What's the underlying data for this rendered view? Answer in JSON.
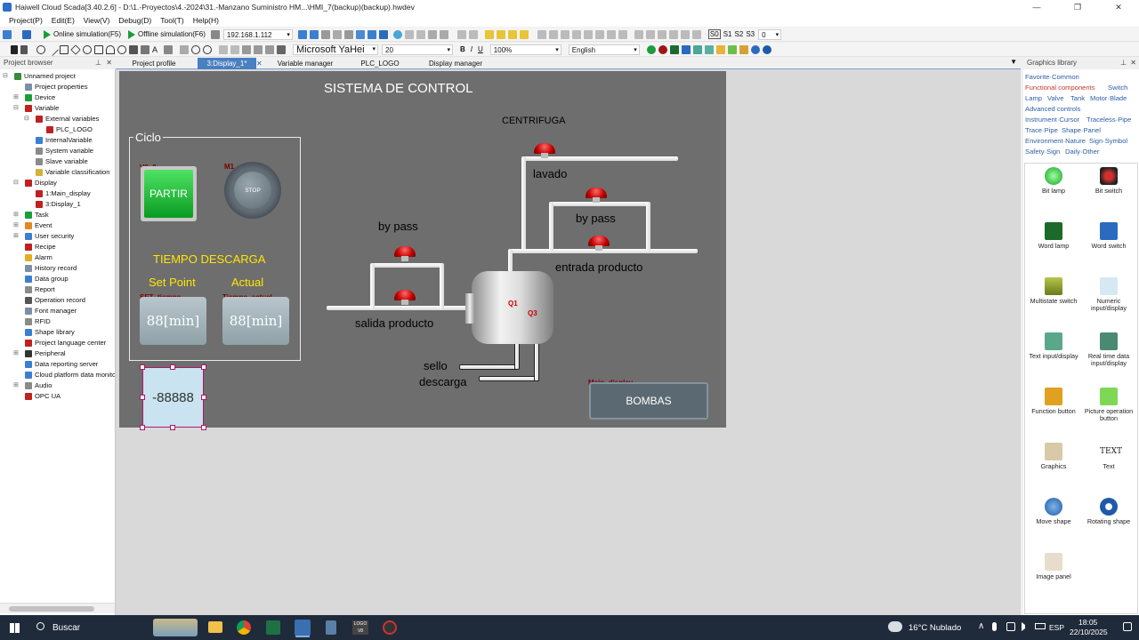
{
  "window": {
    "title": "Haiwell Cloud Scada[3.40.2.6] - D:\\1.-Proyectos\\4.-2024\\31.-Manzano Suministro HM...\\HMI_7(backup)(backup).hwdev",
    "minimize": "—",
    "maximize": "❐",
    "close": "✕"
  },
  "menu": [
    "Project(P)",
    "Edit(E)",
    "View(V)",
    "Debug(D)",
    "Tool(T)",
    "Help(H)"
  ],
  "toolbar1": {
    "online_sim": "Online simulation(F5)",
    "offline_sim": "Offline simulation(F6)",
    "ip": "192.168.1.112",
    "s0": "S0",
    "s1": "S1",
    "s2": "S2",
    "s3": "S3",
    "spin": "0"
  },
  "toolbar2": {
    "font": "Microsoft YaHei",
    "size": "20",
    "bold": "B",
    "italic": "I",
    "underline": "U",
    "zoom": "100%",
    "language": "English"
  },
  "tabs": [
    "Project profile",
    "3:Display_1*",
    "Variable manager",
    "PLC_LOGO",
    "Display manager"
  ],
  "project_browser": {
    "title": "Project browser",
    "items": [
      "Unnamed project",
      "Project properties",
      "Device",
      "Variable",
      "External variables",
      "PLC_LOGO",
      "InternalVariable",
      "System variable",
      "Slave variable",
      "Variable classification",
      "Display",
      "1:Main_display",
      "3:Display_1",
      "Task",
      "Event",
      "User security",
      "Recipe",
      "Alarm",
      "History record",
      "Data group",
      "Report",
      "Operation record",
      "Font manager",
      "RFID",
      "Shape library",
      "Project language center",
      "Peripheral",
      "Data reporting server",
      "Cloud platform data monito",
      "Audio",
      "OPC UA"
    ]
  },
  "display": {
    "title": "SISTEMA DE CONTROL",
    "ciclo": "Ciclo",
    "v0": "V0_0",
    "partir": "PARTIR",
    "m1": "M1",
    "stop": "STOP",
    "tiempo": "TIEMPO DESCARGA",
    "setpoint": "Set Point",
    "actual": "Actual",
    "set_tag": "SET_tiempo",
    "act_tag": "Tiempo_actual",
    "set_val": "88[min]",
    "act_val": "88[min]",
    "numeric": "-88888",
    "centrifuga": "CENTRIFUGA",
    "lavado": "lavado",
    "bypass_right": "by pass",
    "entrada": "entrada producto",
    "bypass_left": "by pass",
    "salida": "salida producto",
    "sello1": "sello",
    "sello2": "descarga",
    "q1": "Q1",
    "q3": "Q3",
    "main_display": "Main_display",
    "bombas": "BOMBAS"
  },
  "graphics_library": {
    "title": "Graphics library",
    "categories": [
      "Favorite·Common",
      "Functional components",
      "Switch",
      "Lamp",
      "Valve",
      "Tank",
      "Motor·Blade",
      "Advanced controls",
      "Instrument·Cursor",
      "Traceless·Pipe",
      "Trace·Pipe",
      "Shape·Panel",
      "Environment·Nature",
      "Sign·Symbol",
      "Safety·Sign",
      "Daily·Other"
    ],
    "items": [
      "Bit lamp",
      "Bit switch",
      "Word lamp",
      "Word switch",
      "Multistate switch",
      "Numeric input/display",
      "Text input/display",
      "Real time data input/display",
      "Function button",
      "Picture operation button",
      "Graphics",
      "Text",
      "Move shape",
      "Rotating shape",
      "Image panel"
    ],
    "text_icon": "TEXT"
  },
  "taskbar": {
    "search": "Buscar",
    "weather": "16°C  Nublado",
    "lang": "ESP",
    "time": "18:05",
    "date": "22/10/2025",
    "logo_app": "LOGO V8"
  }
}
